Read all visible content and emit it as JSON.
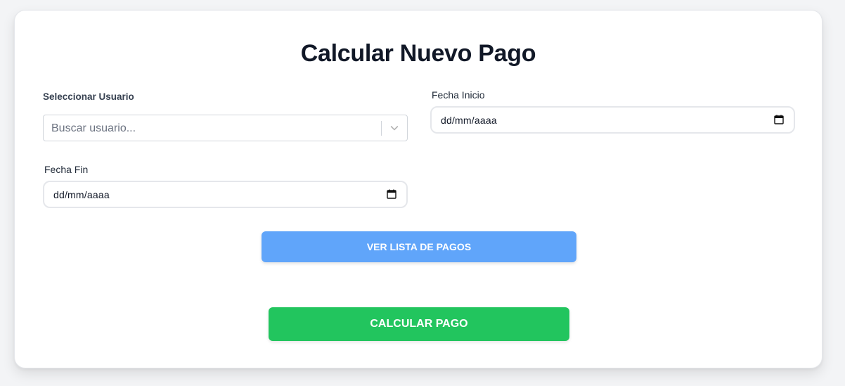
{
  "form": {
    "title": "Calcular Nuevo Pago",
    "user_select": {
      "label": "Seleccionar Usuario",
      "placeholder": "Buscar usuario..."
    },
    "start_date": {
      "label": "Fecha Inicio",
      "value": "dd/mm/aaaa"
    },
    "end_date": {
      "label": "Fecha Fin",
      "value": "dd/mm/aaaa"
    },
    "view_list_button": "VER LISTA DE PAGOS",
    "calculate_button": "CALCULAR PAGO"
  },
  "colors": {
    "list_button": "#60a5fa",
    "calculate_button": "#22c55e",
    "title": "#111827"
  }
}
